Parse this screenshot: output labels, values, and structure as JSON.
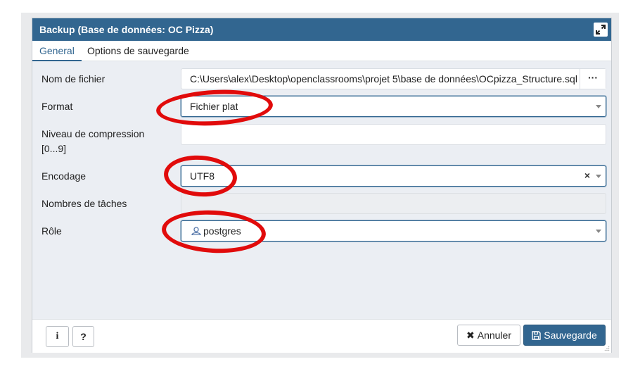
{
  "dialog": {
    "title": "Backup (Base de données: OC Pizza)",
    "maximize_icon": "expand-icon"
  },
  "tabs": [
    {
      "label": "General",
      "active": true
    },
    {
      "label": "Options de sauvegarde",
      "active": false
    }
  ],
  "form": {
    "filename": {
      "label": "Nom de fichier",
      "value": "C:\\Users\\alex\\Desktop\\openclassrooms\\projet 5\\base de données\\OCpizza_Structure.sql",
      "browse_label": "···"
    },
    "format": {
      "label": "Format",
      "value": "Fichier plat"
    },
    "compression": {
      "label_line1": "Niveau de compression",
      "label_line2": "[0...9]",
      "value": ""
    },
    "encoding": {
      "label": "Encodage",
      "value": "UTF8",
      "clear_label": "×"
    },
    "jobs": {
      "label": "Nombres de tâches",
      "value": ""
    },
    "role": {
      "label": "Rôle",
      "value": "postgres",
      "icon": "user-icon"
    }
  },
  "footer": {
    "info_label": "i",
    "help_label": "?",
    "cancel_label": "Annuler",
    "cancel_icon_glyph": "✖",
    "save_label": "Sauvegarde",
    "save_icon": "floppy-disk-icon"
  },
  "colors": {
    "accent": "#326690",
    "panel_bg": "#ebeef3",
    "annotation": "#e10b0b"
  }
}
